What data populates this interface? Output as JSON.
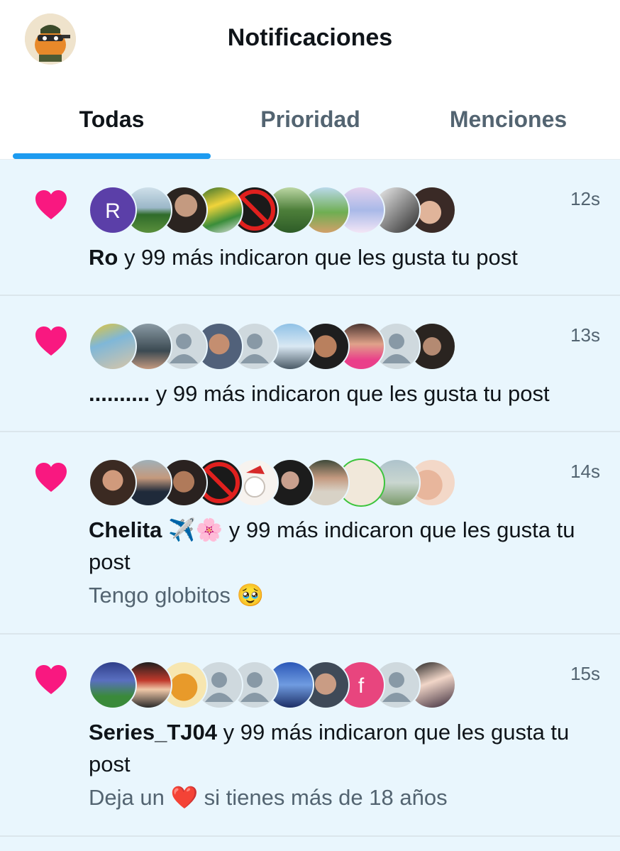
{
  "header": {
    "title": "Notificaciones",
    "profile_avatar_icon": "profile-avatar-cartoon-orange-soldier"
  },
  "tabs": [
    {
      "label": "Todas",
      "active": true
    },
    {
      "label": "Prioridad",
      "active": false
    },
    {
      "label": "Menciones",
      "active": false
    }
  ],
  "colors": {
    "accent": "#1d9bf0",
    "like": "#f91880",
    "feed_background": "#e9f6fd",
    "secondary_text": "#536471"
  },
  "notifications": [
    {
      "icon": "heart-icon",
      "time": "12s",
      "name": "Ro",
      "action": " y 99 más indicaron que les gusta tu post",
      "subtext": ""
    },
    {
      "icon": "heart-icon",
      "time": "13s",
      "name": "..........",
      "action": " y 99 más indicaron que les gusta tu post",
      "subtext": ""
    },
    {
      "icon": "heart-icon",
      "time": "14s",
      "name": "Chelita ✈️🌸",
      "action": " y 99 más indicaron que les gusta tu post",
      "subtext": "Tengo globitos 🥹"
    },
    {
      "icon": "heart-icon",
      "time": "15s",
      "name": "Series_TJ04",
      "action": " y 99 más indicaron que les gusta tu post",
      "subtext": "Deja un ❤️ si tienes más de 18 años"
    }
  ],
  "avatar_letters": {
    "first_row_first": "R",
    "fourth_row_seventh": "f"
  }
}
